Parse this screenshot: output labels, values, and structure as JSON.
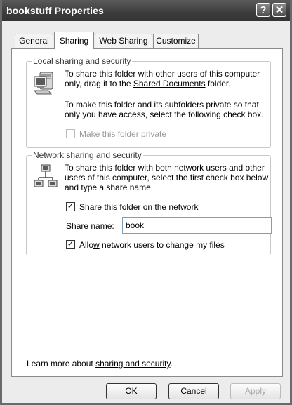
{
  "window": {
    "title": "bookstuff Properties",
    "help_label": "?",
    "close_label": "✕"
  },
  "tabs": [
    {
      "label": "General"
    },
    {
      "label": "Sharing"
    },
    {
      "label": "Web Sharing"
    },
    {
      "label": "Customize"
    }
  ],
  "local": {
    "legend": "Local sharing and security",
    "text_pre": "To share this folder with other users of this computer only, drag it to the ",
    "link": "Shared Documents",
    "text_post": " folder.",
    "private_text": "To make this folder and its subfolders private so that only you have access, select the following check box.",
    "private_checkbox_label_key": "M",
    "private_checkbox_label_rest": "ake this folder private"
  },
  "network": {
    "legend": "Network sharing and security",
    "text": "To share this folder with both network users and other users of this computer, select the first check box below and type a share name.",
    "share_checkbox_key": "S",
    "share_checkbox_rest": "hare this folder on the network",
    "share_name_label_a": "Sh",
    "share_name_label_key": "a",
    "share_name_label_b": "re name:",
    "share_name_value": "book",
    "allow_checkbox_a": "Allo",
    "allow_checkbox_key": "w",
    "allow_checkbox_b": " network users to change my files"
  },
  "footer": {
    "learn_text": "Learn more about ",
    "learn_link": "sharing and security",
    "learn_end": "."
  },
  "buttons": {
    "ok": "OK",
    "cancel": "Cancel",
    "apply": "Apply"
  }
}
